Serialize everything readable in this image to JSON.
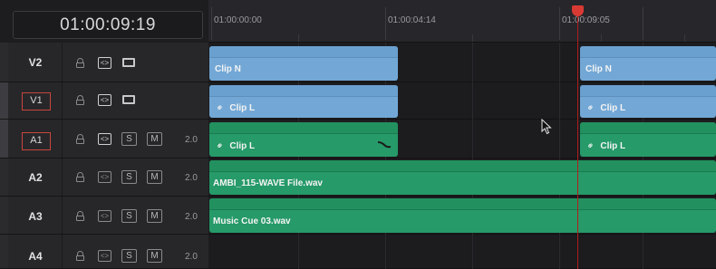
{
  "timecode": "01:00:09:19",
  "ruler": {
    "labels": [
      "01:00:00:00",
      "01:00:04:14",
      "01:00:09:05"
    ]
  },
  "tracks": [
    {
      "name": "V2",
      "type": "video",
      "selected": false
    },
    {
      "name": "V1",
      "type": "video",
      "selected": true
    },
    {
      "name": "A1",
      "type": "audio",
      "selected": true,
      "volume": "2.0"
    },
    {
      "name": "A2",
      "type": "audio",
      "selected": false,
      "volume": "2.0"
    },
    {
      "name": "A3",
      "type": "audio",
      "selected": false,
      "volume": "2.0"
    },
    {
      "name": "A4",
      "type": "audio",
      "selected": false,
      "volume": "2.0"
    }
  ],
  "buttons": {
    "solo": "S",
    "mute": "M"
  },
  "clips": {
    "v2_a": "Clip N",
    "v2_b": "Clip N",
    "v1_a": "Clip L",
    "v1_b": "Clip L",
    "a1_a": "Clip L",
    "a1_b": "Clip L",
    "a2": "AMBI_115-WAVE File.wav",
    "a3": "Music Cue 03.wav"
  },
  "colors": {
    "video_clip": "#73a8d6",
    "audio_clip": "#269a69",
    "playhead": "#d83a33",
    "track_selected_outline": "#c7463b"
  }
}
